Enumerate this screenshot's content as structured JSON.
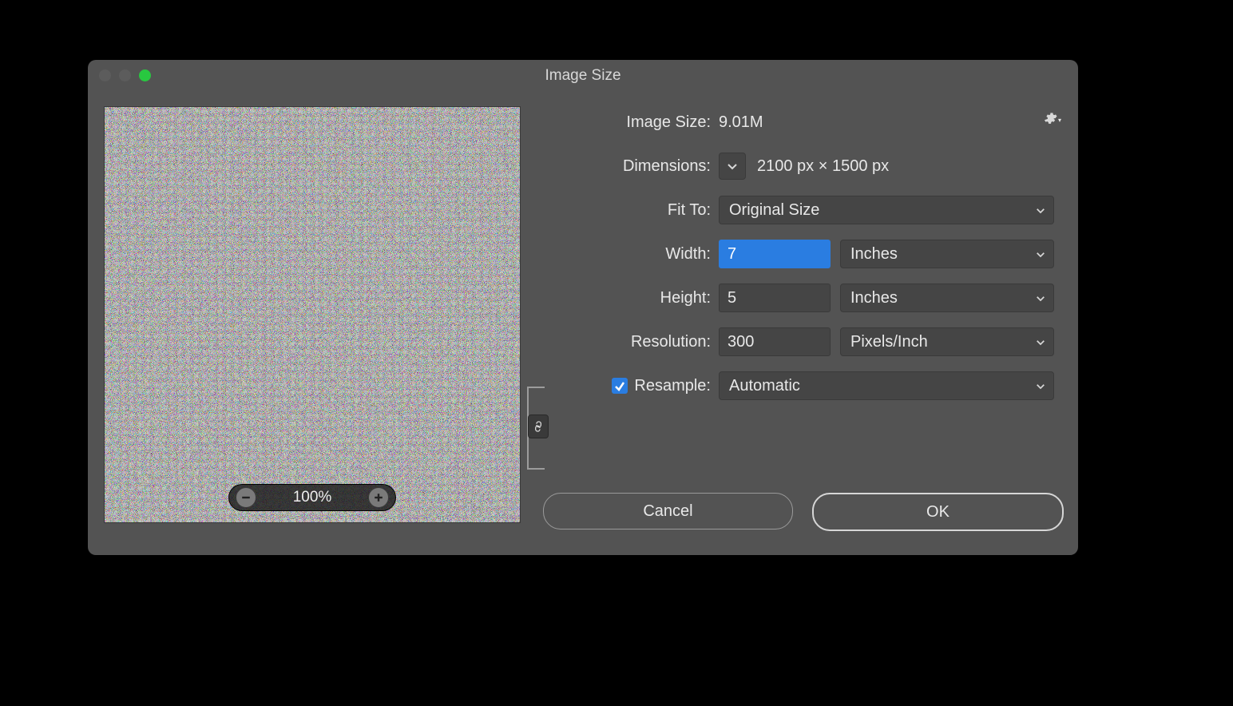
{
  "window": {
    "title": "Image Size"
  },
  "preview": {
    "zoom_label": "100%"
  },
  "panel": {
    "image_size_label": "Image Size:",
    "image_size_value": "9.01M",
    "dimensions_label": "Dimensions:",
    "dimensions_value": "2100 px  ×  1500 px",
    "fit_to_label": "Fit To:",
    "fit_to_value": "Original Size",
    "width_label": "Width:",
    "width_value": "7",
    "width_unit": "Inches",
    "height_label": "Height:",
    "height_value": "5",
    "height_unit": "Inches",
    "resolution_label": "Resolution:",
    "resolution_value": "300",
    "resolution_unit": "Pixels/Inch",
    "resample_label": "Resample:",
    "resample_value": "Automatic",
    "resample_checked": true
  },
  "buttons": {
    "cancel": "Cancel",
    "ok": "OK"
  }
}
